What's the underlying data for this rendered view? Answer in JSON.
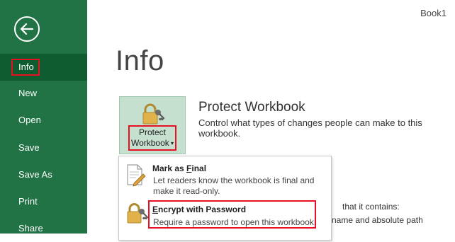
{
  "window": {
    "document_name": "Book1"
  },
  "nav": {
    "back_icon": "back-arrow-icon",
    "items": [
      {
        "label": "Info",
        "active": true
      },
      {
        "label": "New"
      },
      {
        "label": "Open"
      },
      {
        "label": "Save"
      },
      {
        "label": "Save As"
      },
      {
        "label": "Print"
      },
      {
        "label": "Share"
      }
    ]
  },
  "page": {
    "title": "Info"
  },
  "protect": {
    "tile_icon": "lock-key-icon",
    "button_line1": "Protect",
    "button_line2": "Workbook",
    "heading": "Protect Workbook",
    "description": "Control what types of changes people can make to this workbook."
  },
  "background_text": {
    "line1": "that it contains:",
    "line2": "name and absolute path"
  },
  "menu": {
    "items": [
      {
        "icon": "document-pencil-icon",
        "title_pre": "Mark as ",
        "title_accel": "F",
        "title_post": "inal",
        "desc_line1": "Let readers know the workbook is final and",
        "desc_line2": "make it read-only."
      },
      {
        "icon": "lock-key-icon",
        "title_pre": "",
        "title_accel": "E",
        "title_post": "ncrypt with Password",
        "desc_line1": "Require a password to open this workbook."
      }
    ]
  },
  "colors": {
    "nav_bg": "#217346",
    "nav_active": "#0e5c2f",
    "tile_bg": "#c6e0d0",
    "highlight": "#e81123"
  }
}
